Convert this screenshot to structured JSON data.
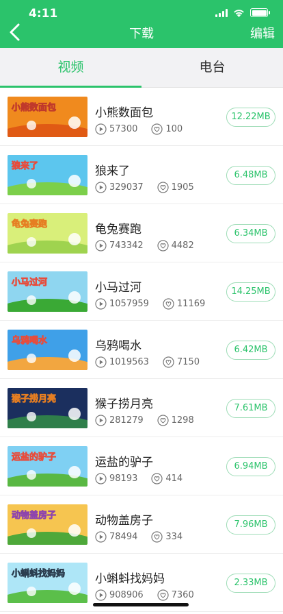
{
  "status_bar": {
    "time": "4:11"
  },
  "nav": {
    "title": "下载",
    "edit_label": "编辑"
  },
  "tabs": [
    {
      "label": "视频",
      "active": true
    },
    {
      "label": "电台",
      "active": false
    }
  ],
  "accent_color": "#2bc36b",
  "items": [
    {
      "title": "小熊数面包",
      "plays": "57300",
      "likes": "100",
      "size": "12.22MB",
      "thumb_text": "小熊数面包"
    },
    {
      "title": "狼来了",
      "plays": "329037",
      "likes": "1905",
      "size": "6.48MB",
      "thumb_text": "狼来了"
    },
    {
      "title": "龟兔赛跑",
      "plays": "743342",
      "likes": "4482",
      "size": "6.34MB",
      "thumb_text": "龟兔赛跑"
    },
    {
      "title": "小马过河",
      "plays": "1057959",
      "likes": "11169",
      "size": "14.25MB",
      "thumb_text": "小马过河"
    },
    {
      "title": "乌鸦喝水",
      "plays": "1019563",
      "likes": "7150",
      "size": "6.42MB",
      "thumb_text": "乌鸦喝水"
    },
    {
      "title": "猴子捞月亮",
      "plays": "281279",
      "likes": "1298",
      "size": "7.61MB",
      "thumb_text": "猴子捞月亮"
    },
    {
      "title": "运盐的驴子",
      "plays": "98193",
      "likes": "414",
      "size": "6.94MB",
      "thumb_text": "运盐的驴子"
    },
    {
      "title": "动物盖房子",
      "plays": "78494",
      "likes": "334",
      "size": "7.96MB",
      "thumb_text": "动物盖房子"
    },
    {
      "title": "小蝌蚪找妈妈",
      "plays": "908906",
      "likes": "7360",
      "size": "2.33MB",
      "thumb_text": "小蝌蚪找妈妈"
    }
  ]
}
